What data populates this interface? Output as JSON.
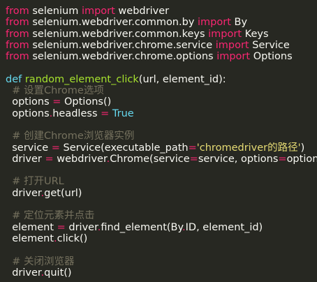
{
  "lines": [
    [
      {
        "t": "from",
        "c": "kw"
      },
      {
        "t": " selenium ",
        "c": "plain"
      },
      {
        "t": "import",
        "c": "kw"
      },
      {
        "t": " webdriver",
        "c": "plain"
      }
    ],
    [
      {
        "t": "from",
        "c": "kw"
      },
      {
        "t": " selenium.webdriver.common.by ",
        "c": "plain"
      },
      {
        "t": "import",
        "c": "kw"
      },
      {
        "t": " By",
        "c": "plain"
      }
    ],
    [
      {
        "t": "from",
        "c": "kw"
      },
      {
        "t": " selenium.webdriver.common.keys ",
        "c": "plain"
      },
      {
        "t": "import",
        "c": "kw"
      },
      {
        "t": " Keys",
        "c": "plain"
      }
    ],
    [
      {
        "t": "from",
        "c": "kw"
      },
      {
        "t": " selenium.webdriver.chrome.service ",
        "c": "plain"
      },
      {
        "t": "import",
        "c": "kw"
      },
      {
        "t": " Service",
        "c": "plain"
      }
    ],
    [
      {
        "t": "from",
        "c": "kw"
      },
      {
        "t": " selenium.webdriver.chrome.options ",
        "c": "plain"
      },
      {
        "t": "import",
        "c": "kw"
      },
      {
        "t": " Options",
        "c": "plain"
      }
    ],
    [],
    [
      {
        "t": "def",
        "c": "num"
      },
      {
        "t": " ",
        "c": "plain"
      },
      {
        "t": "random_element_click",
        "c": "fn"
      },
      {
        "t": "(url, element_id):",
        "c": "plain"
      }
    ],
    [
      {
        "t": "  # 设置Chrome选项",
        "c": "cm"
      }
    ],
    [
      {
        "t": "  options ",
        "c": "plain"
      },
      {
        "t": "=",
        "c": "kw"
      },
      {
        "t": " Options()",
        "c": "plain"
      }
    ],
    [
      {
        "t": "  options",
        "c": "plain"
      },
      {
        "t": ".",
        "c": "kw"
      },
      {
        "t": "headless ",
        "c": "plain"
      },
      {
        "t": "=",
        "c": "kw"
      },
      {
        "t": " ",
        "c": "plain"
      },
      {
        "t": "True",
        "c": "num"
      }
    ],
    [],
    [
      {
        "t": "  # 创建Chrome浏览器实例",
        "c": "cm"
      }
    ],
    [
      {
        "t": "  service ",
        "c": "plain"
      },
      {
        "t": "=",
        "c": "kw"
      },
      {
        "t": " Service(executable_path",
        "c": "plain"
      },
      {
        "t": "=",
        "c": "kw"
      },
      {
        "t": "'chromedriver的路径'",
        "c": "str"
      },
      {
        "t": ")",
        "c": "plain"
      }
    ],
    [
      {
        "t": "  driver ",
        "c": "plain"
      },
      {
        "t": "=",
        "c": "kw"
      },
      {
        "t": " webdriver",
        "c": "plain"
      },
      {
        "t": ".",
        "c": "kw"
      },
      {
        "t": "Chrome(service",
        "c": "plain"
      },
      {
        "t": "=",
        "c": "kw"
      },
      {
        "t": "service, options",
        "c": "plain"
      },
      {
        "t": "=",
        "c": "kw"
      },
      {
        "t": "options)",
        "c": "plain"
      }
    ],
    [],
    [
      {
        "t": "  # 打开URL",
        "c": "cm"
      }
    ],
    [
      {
        "t": "  driver",
        "c": "plain"
      },
      {
        "t": ".",
        "c": "kw"
      },
      {
        "t": "get(url)",
        "c": "plain"
      }
    ],
    [],
    [
      {
        "t": "  # 定位元素并点击",
        "c": "cm"
      }
    ],
    [
      {
        "t": "  element ",
        "c": "plain"
      },
      {
        "t": "=",
        "c": "kw"
      },
      {
        "t": " driver",
        "c": "plain"
      },
      {
        "t": ".",
        "c": "kw"
      },
      {
        "t": "find_element(By",
        "c": "plain"
      },
      {
        "t": ".",
        "c": "kw"
      },
      {
        "t": "ID, element_id)",
        "c": "plain"
      }
    ],
    [
      {
        "t": "  element",
        "c": "plain"
      },
      {
        "t": ".",
        "c": "kw"
      },
      {
        "t": "click()",
        "c": "plain"
      }
    ],
    [],
    [
      {
        "t": "  # 关闭浏览器",
        "c": "cm"
      }
    ],
    [
      {
        "t": "  driver",
        "c": "plain"
      },
      {
        "t": ".",
        "c": "kw"
      },
      {
        "t": "quit()",
        "c": "plain"
      }
    ]
  ]
}
